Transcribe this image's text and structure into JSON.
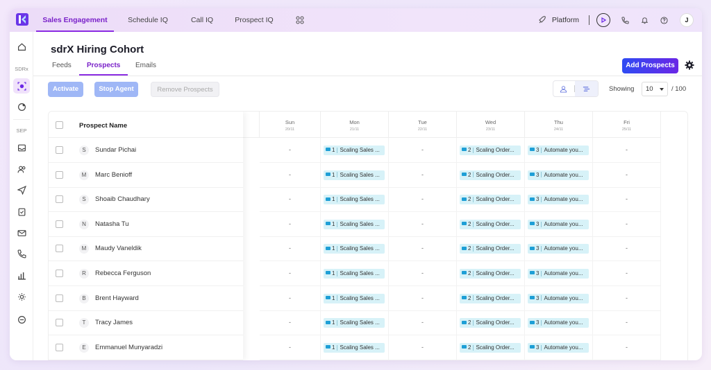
{
  "nav": {
    "tabs": [
      {
        "label": "Sales Engagement",
        "active": true
      },
      {
        "label": "Schedule IQ"
      },
      {
        "label": "Call IQ"
      },
      {
        "label": "Prospect IQ"
      }
    ],
    "platform_label": "Platform",
    "user_initial": "J"
  },
  "sidebar": {
    "section_sdrx": "SDRx",
    "section_sep": "SEP"
  },
  "page": {
    "title": "sdrX Hiring Cohort",
    "tabs": [
      {
        "label": "Feeds"
      },
      {
        "label": "Prospects",
        "active": true
      },
      {
        "label": "Emails"
      }
    ],
    "add_button": "Add Prospects"
  },
  "toolbar": {
    "activate": "Activate",
    "stop_agent": "Stop Agent",
    "remove": "Remove Prospects",
    "showing_label": "Showing",
    "page_size": "10",
    "total": "/ 100"
  },
  "table": {
    "name_header": "Prospect Name",
    "days": [
      {
        "name": "Sun",
        "date": "20/11"
      },
      {
        "name": "Mon",
        "date": "21/11"
      },
      {
        "name": "Tue",
        "date": "22/11"
      },
      {
        "name": "Wed",
        "date": "23/11"
      },
      {
        "name": "Thu",
        "date": "24/11"
      },
      {
        "name": "Fri",
        "date": "25/11"
      }
    ],
    "empty": "-",
    "chips": {
      "mon": {
        "num": "1",
        "text": "Scaling Sales ..."
      },
      "wed": {
        "num": "2",
        "text": "Scaling Order..."
      },
      "thu": {
        "num": "3",
        "text": "Automate you..."
      }
    },
    "rows": [
      {
        "initial": "S",
        "name": "Sundar Pichai"
      },
      {
        "initial": "M",
        "name": "Marc Benioff"
      },
      {
        "initial": "S",
        "name": "Shoaib Chaudhary"
      },
      {
        "initial": "N",
        "name": "Natasha Tu"
      },
      {
        "initial": "M",
        "name": "Maudy Vaneldik"
      },
      {
        "initial": "R",
        "name": "Rebecca Ferguson"
      },
      {
        "initial": "B",
        "name": "Brent Hayward"
      },
      {
        "initial": "T",
        "name": "Tracy James"
      },
      {
        "initial": "E",
        "name": "Emmanuel Munyaradzi"
      }
    ]
  },
  "colors": {
    "accent": "#8a2be2",
    "button_primary": "#2e4bf3",
    "chip_bg": "#d7f2f8"
  }
}
